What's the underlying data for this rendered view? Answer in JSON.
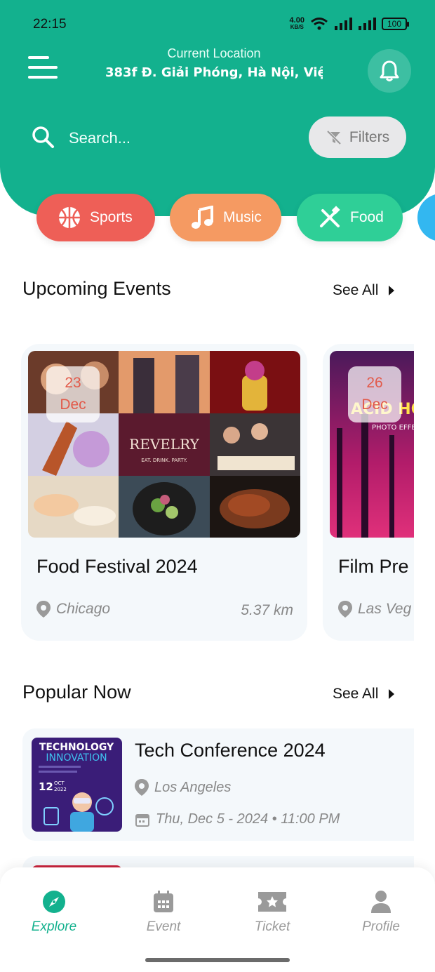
{
  "status_bar": {
    "time": "22:15",
    "net_speed_top": "4.00",
    "net_speed_bottom": "KB/S",
    "battery": "100"
  },
  "header": {
    "location_label": "Current Location",
    "location_value": "383f Đ. Giải Phóng, Hà Nội, Việ...",
    "search_placeholder": "Search...",
    "filters_label": "Filters"
  },
  "categories": [
    {
      "label": "Sports",
      "color": "#ee5f57",
      "icon": "basketball-icon"
    },
    {
      "label": "Music",
      "color": "#f59a62",
      "icon": "music-note-icon"
    },
    {
      "label": "Food",
      "color": "#2fcf97",
      "icon": "utensils-icon"
    }
  ],
  "upcoming": {
    "title": "Upcoming Events",
    "see_all": "See All",
    "events": [
      {
        "day": "23",
        "month": "Dec",
        "title": "Food Festival 2024",
        "location": "Chicago",
        "distance": "5.37 km",
        "image_text": "REVELRY",
        "image_subtext": "EAT. DRINK. PARTY."
      },
      {
        "day": "26",
        "month": "Dec",
        "title": "Film Pre",
        "location": "Las Veg",
        "distance": "",
        "image_text": "ACID HOU",
        "image_subtext": "PHOTO EFFE"
      }
    ]
  },
  "popular": {
    "title": "Popular Now",
    "see_all": "See All",
    "items": [
      {
        "title": "Tech Conference 2024",
        "location": "Los Angeles",
        "datetime": "Thu, Dec 5 - 2024 • 11:00 PM",
        "thumb_line1": "TECHNOLOGY",
        "thumb_line2": "INNOVATION",
        "thumb_day": "12",
        "thumb_month": "OCT",
        "thumb_year": "2022"
      }
    ]
  },
  "bottom_nav": [
    {
      "label": "Explore",
      "icon": "compass-icon",
      "active": true
    },
    {
      "label": "Event",
      "icon": "calendar-icon",
      "active": false
    },
    {
      "label": "Ticket",
      "icon": "ticket-icon",
      "active": false
    },
    {
      "label": "Profile",
      "icon": "user-icon",
      "active": false
    }
  ],
  "colors": {
    "primary": "#13b18e",
    "badge_text": "#e25a4a",
    "muted": "#888888"
  }
}
